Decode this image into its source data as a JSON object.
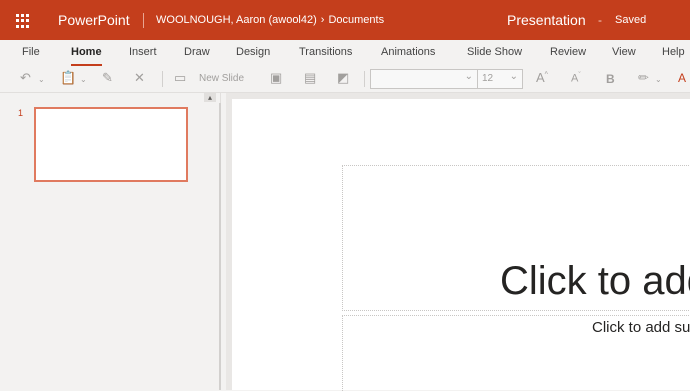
{
  "titlebar": {
    "app_name": "PowerPoint",
    "user_location": "WOOLNOUGH, Aaron (awool42)",
    "folder": "Documents",
    "document_name": "Presentation",
    "separator": "-",
    "save_status": "Saved"
  },
  "ribbon": {
    "tabs": [
      "File",
      "Home",
      "Insert",
      "Draw",
      "Design",
      "Transitions",
      "Animations",
      "Slide Show",
      "Review",
      "View",
      "Help"
    ],
    "active_tab": "Home"
  },
  "toolbar": {
    "new_slide_label": "New Slide",
    "font_name_value": "",
    "font_size_value": "12",
    "bold_label": "B"
  },
  "thumbnails": {
    "slide_number": "1"
  },
  "slide": {
    "title_placeholder": "Click to add title",
    "subtitle_placeholder": "Click to add subtitle"
  },
  "colors": {
    "brand": "#c43e1c",
    "thumb_border": "#e07a5f"
  }
}
